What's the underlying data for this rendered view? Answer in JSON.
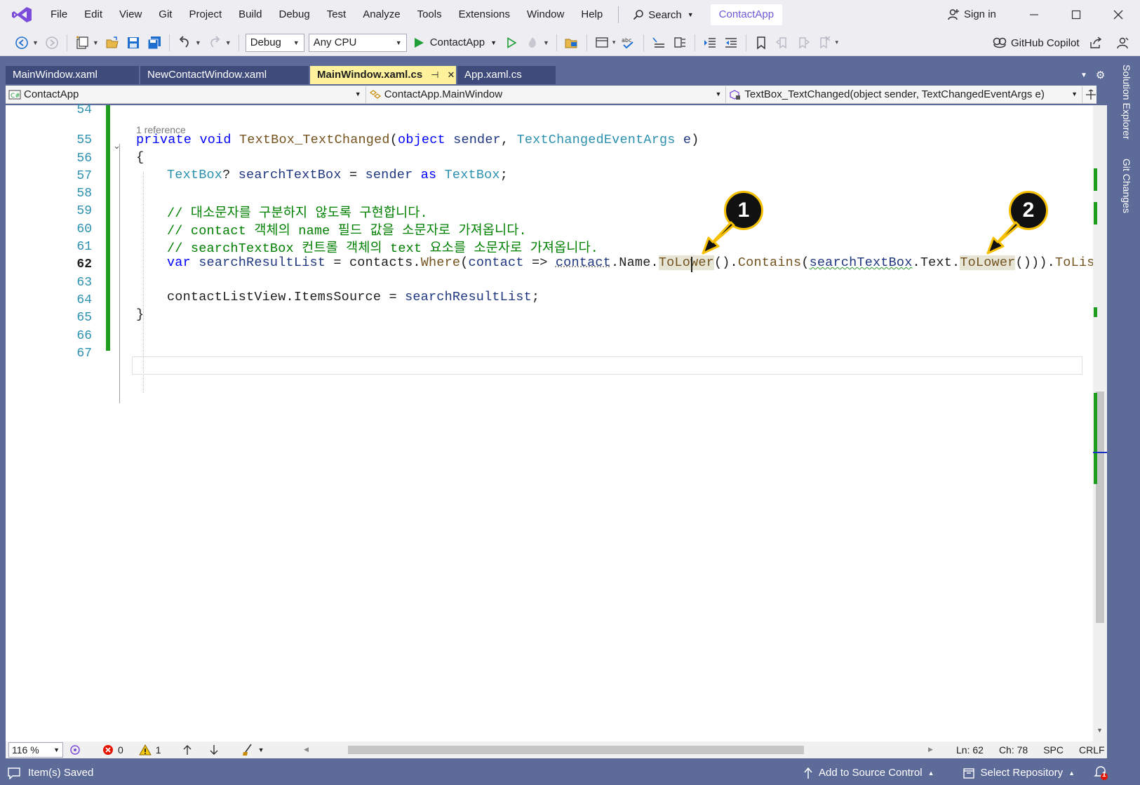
{
  "menu": {
    "items": [
      "File",
      "Edit",
      "View",
      "Git",
      "Project",
      "Build",
      "Debug",
      "Test",
      "Analyze",
      "Tools",
      "Extensions",
      "Window",
      "Help"
    ],
    "search_label": "Search",
    "project_name": "ContactApp",
    "signin_label": "Sign in"
  },
  "toolbar": {
    "config": "Debug",
    "platform": "Any CPU",
    "start_label": "ContactApp",
    "copilot_label": "GitHub Copilot"
  },
  "tabs": [
    {
      "label": "MainWindow.xaml",
      "active": false
    },
    {
      "label": "NewContactWindow.xaml",
      "active": false
    },
    {
      "label": "MainWindow.xaml.cs",
      "active": true
    },
    {
      "label": "App.xaml.cs",
      "active": false
    }
  ],
  "side_tabs": [
    "Solution Explorer",
    "Git Changes"
  ],
  "navbar": {
    "project": "ContactApp",
    "type": "ContactApp.MainWindow",
    "member": "TextBox_TextChanged(object sender, TextChangedEventArgs e)"
  },
  "editor": {
    "codelens": "1 reference",
    "line_numbers": [
      "54",
      "55",
      "56",
      "57",
      "58",
      "59",
      "60",
      "61",
      "62",
      "63",
      "64",
      "65",
      "66",
      "67"
    ],
    "current_line": "62",
    "code": {
      "l55": [
        "private",
        "void",
        "TextBox_TextChanged",
        "(",
        "object",
        "sender",
        ", ",
        "TextChangedEventArgs",
        "e",
        ")"
      ],
      "l56": "{",
      "l57": [
        "TextBox",
        "? ",
        "searchTextBox",
        " = ",
        "sender",
        "as",
        "TextBox",
        ";"
      ],
      "l59": "// 대소문자를 구분하지 않도록 구현합니다.",
      "l60": "// contact 객체의 name 필드 값을 소문자로 가져옵니다.",
      "l61": "// searchTextBox 컨트롤 객체의 text 요소를 소문자로 가져옵니다.",
      "l62": [
        "var",
        "searchResultList",
        " = ",
        "contacts",
        ".",
        "Where",
        "(",
        "contact",
        " => ",
        "contact",
        ".Name.",
        "ToLower",
        "().",
        "Contains",
        "(",
        "searchTextBox",
        ".Text.",
        "ToLower",
        "())).",
        "ToLis"
      ],
      "l64": [
        "contactListView",
        ".ItemsSource = ",
        "searchResultList",
        ";"
      ],
      "l65": "}"
    }
  },
  "callouts": [
    "1",
    "2"
  ],
  "editor_status": {
    "zoom": "116 %",
    "errors": "0",
    "warnings": "1",
    "line": "Ln: 62",
    "col": "Ch: 78",
    "whitespace": "SPC",
    "line_ending": "CRLF"
  },
  "statusbar": {
    "message": "Item(s) Saved",
    "source_control": "Add to Source Control",
    "repository": "Select Repository",
    "notifications": "1"
  },
  "colors": {
    "frame": "#5d6b99",
    "active_tab": "#fff29d",
    "change_bar": "#1e9e1e",
    "accent": "#6c57d6",
    "callout_border": "#f6c000"
  }
}
